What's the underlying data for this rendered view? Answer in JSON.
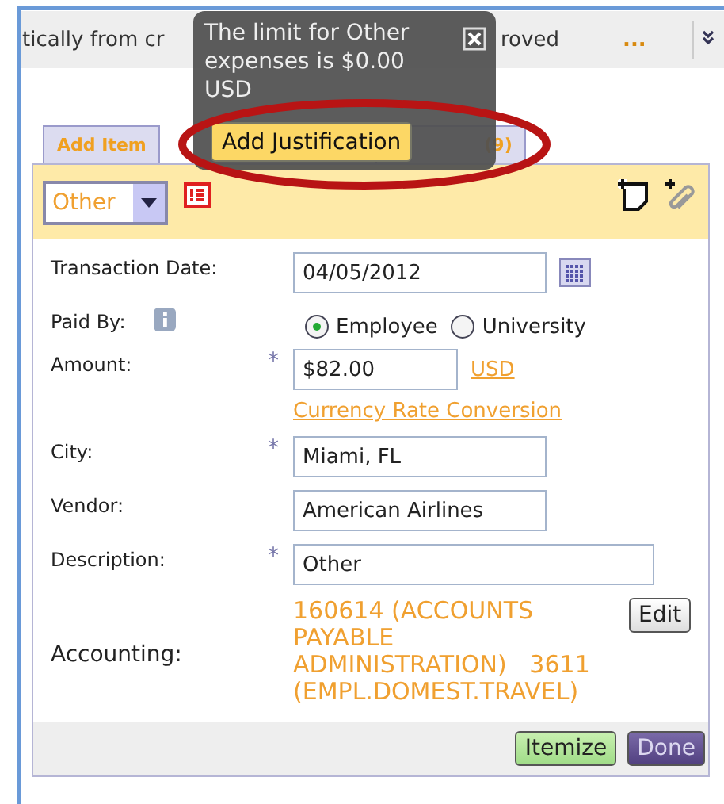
{
  "banner": {
    "text_start": "tically from cr",
    "text_end": "roved",
    "more": "..."
  },
  "tabs": [
    {
      "label": "Add Item",
      "selected": false
    },
    {
      "label": "(9)",
      "selected": false
    }
  ],
  "header": {
    "category": "Other"
  },
  "fields": [
    {
      "kind": "date",
      "label": "Transaction Date:",
      "value": "04/05/2012"
    },
    {
      "kind": "radio",
      "label": "Paid By:",
      "options": [
        {
          "label": "Employee",
          "selected": true
        },
        {
          "label": "University",
          "selected": false
        }
      ]
    },
    {
      "kind": "amount",
      "label": "Amount:",
      "required_mark": "*",
      "value": "$82.00",
      "currency": "USD",
      "link": "Currency Rate Conversion"
    },
    {
      "kind": "text",
      "label": "City:",
      "required_mark": "*",
      "value": "Miami, FL"
    },
    {
      "kind": "text",
      "label": "Vendor:",
      "value": "American Airlines"
    },
    {
      "kind": "wide",
      "label": "Description:",
      "required_mark": "*",
      "value": "Other"
    },
    {
      "kind": "accounting",
      "label": "Accounting:",
      "value": "160614 (ACCOUNTS PAYABLE ADMINISTRATION)   3611 (EMPL.DOMEST.TRAVEL)",
      "button": "Edit"
    }
  ],
  "footer_buttons": [
    {
      "label": "Itemize",
      "kind": "secondary"
    },
    {
      "label": "Done",
      "kind": "primary"
    }
  ],
  "tooltip": {
    "message": "The limit for Other expenses is $0.00 USD",
    "button": "Add Justification"
  }
}
